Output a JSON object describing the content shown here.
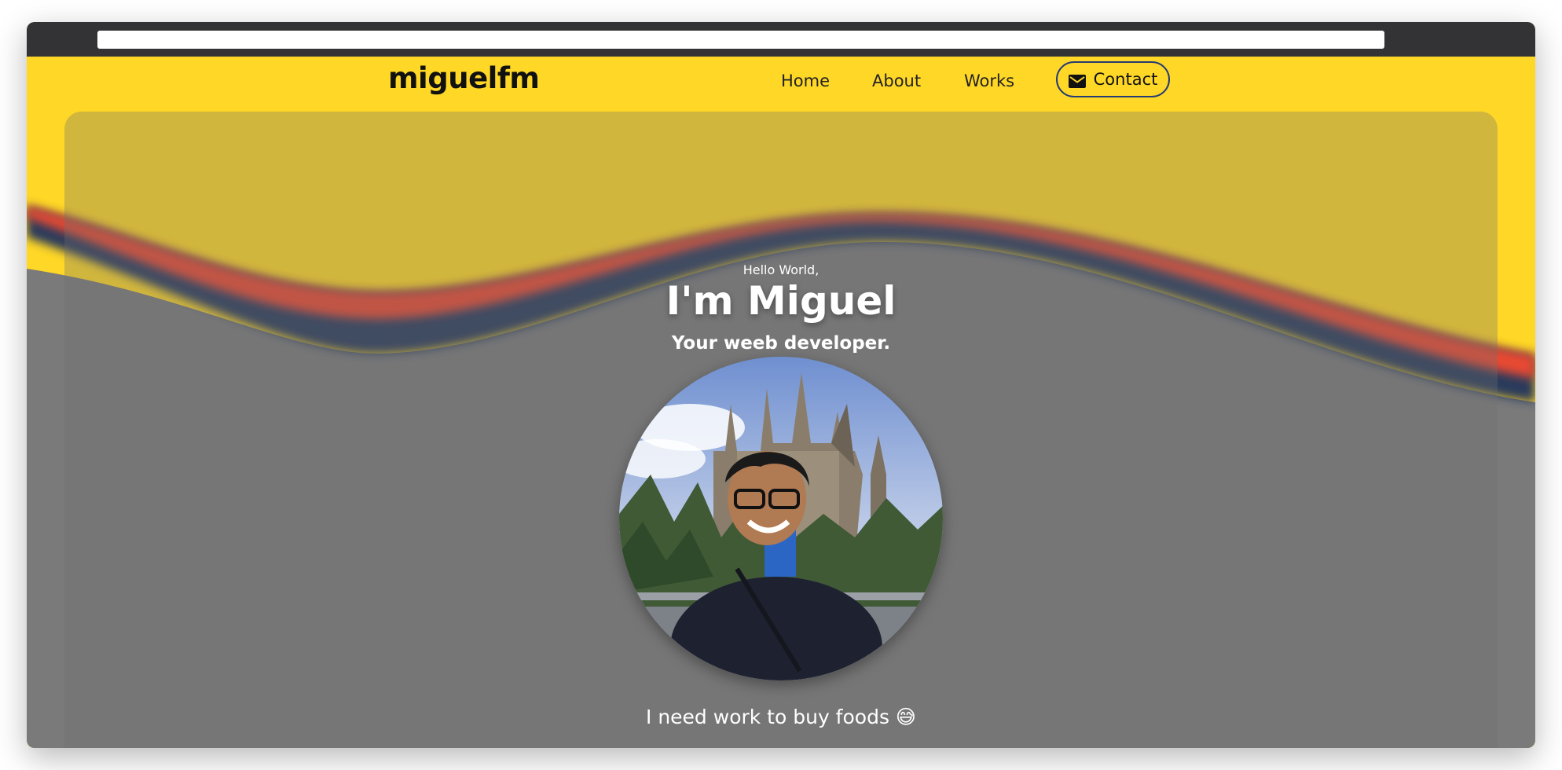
{
  "site": {
    "logo": "miguelfm",
    "nav": {
      "home": "Home",
      "about": "About",
      "works": "Works",
      "contact": "Contact"
    }
  },
  "icons": {
    "contact": "mail-icon",
    "photo": "avatar-photo"
  },
  "hero": {
    "greeting": "Hello World,",
    "name": "I'm Miguel",
    "tagline": "Your weeb developer.",
    "footer_text": "I need work to buy foods 😅"
  },
  "colors": {
    "background_yellow": "#ffd726",
    "wave_red": "#e84a30",
    "wave_navy": "#2a3a5c",
    "overlay_gray": "#7a7a7a",
    "chrome_dark": "#333335",
    "contact_border": "#253b73"
  }
}
